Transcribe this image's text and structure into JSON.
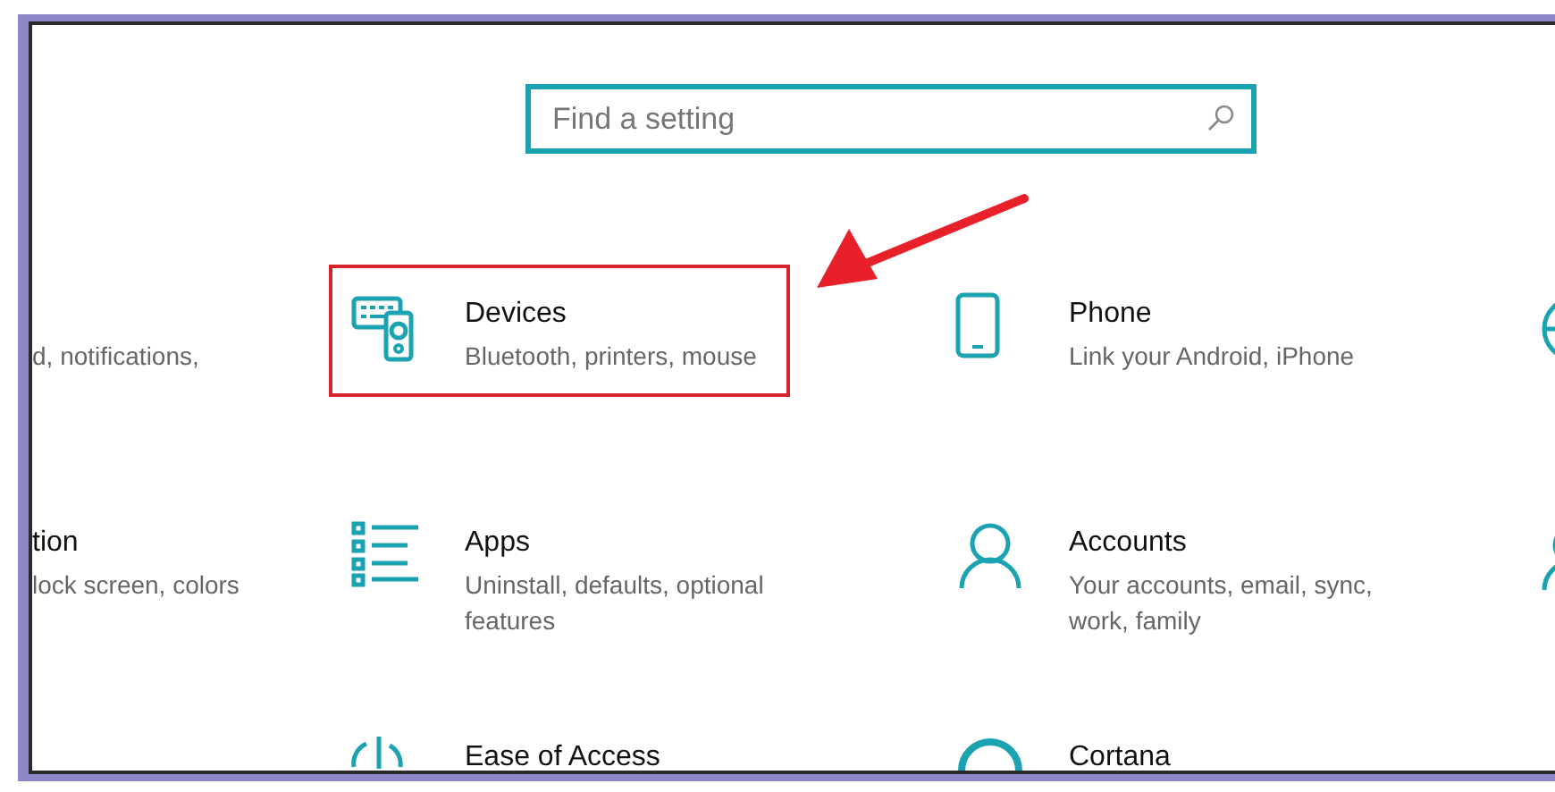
{
  "search": {
    "placeholder": "Find a setting"
  },
  "columns": [
    {
      "tiles": [
        {
          "subtitle": "d, notifications,",
          "highlighted": false
        },
        {
          "title": "tion",
          "subtitle": "lock screen, colors",
          "highlighted": false
        }
      ]
    },
    {
      "tiles": [
        {
          "title": "Devices",
          "subtitle": "Bluetooth, printers, mouse",
          "highlighted": true
        },
        {
          "title": "Apps",
          "subtitle": "Uninstall, defaults, optional features",
          "highlighted": false
        },
        {
          "title": "Ease of Access",
          "highlighted": false
        }
      ]
    },
    {
      "tiles": [
        {
          "title": "Phone",
          "subtitle": "Link your Android, iPhone",
          "highlighted": false
        },
        {
          "title": "Accounts",
          "subtitle": "Your accounts, email, sync, work, family",
          "highlighted": false
        },
        {
          "title": "Cortana",
          "highlighted": false
        }
      ]
    },
    {
      "tiles": [
        {
          "highlighted": false
        },
        {
          "highlighted": false
        }
      ]
    }
  ]
}
